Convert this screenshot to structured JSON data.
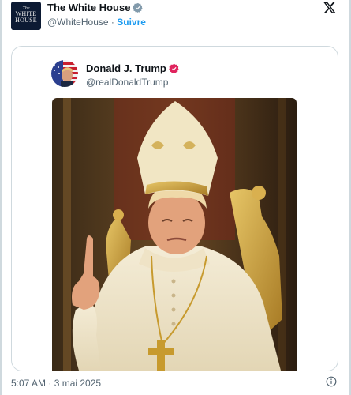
{
  "author": {
    "avatar_line1": "The",
    "avatar_line2": "WHITE",
    "avatar_line3": "HOUSE",
    "display_name": "The White House",
    "handle": "@WhiteHouse",
    "separator": "·",
    "follow_label": "Suivre",
    "verified": "gray-verified-badge"
  },
  "quoted": {
    "display_name": "Donald J. Trump",
    "handle": "@realDonaldTrump",
    "verified": "red-verified-badge",
    "image_alt": "image of a man dressed as a pope seated on a throne"
  },
  "footer": {
    "timestamp": "5:07 AM · 3 mai 2025"
  },
  "icons": {
    "close": "x-logo-icon",
    "info": "info-icon"
  },
  "colors": {
    "link": "#1d9bf0",
    "secondary_text": "#536471",
    "border": "#cfd9de",
    "verified_red": "#e0245e"
  }
}
